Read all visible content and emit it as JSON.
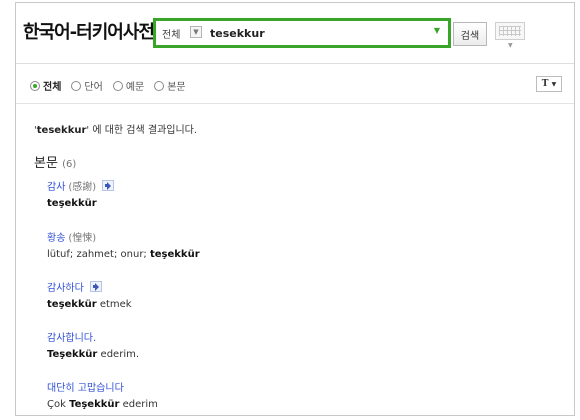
{
  "header": {
    "title": "한국어-터키어사전",
    "scope_label": "전체",
    "query_value": "tesekkur",
    "search_button": "검색"
  },
  "filters": [
    {
      "label": "전체",
      "selected": true
    },
    {
      "label": "단어",
      "selected": false
    },
    {
      "label": "예문",
      "selected": false
    },
    {
      "label": "본문",
      "selected": false
    }
  ],
  "font_button": "T",
  "summary": {
    "quote_open": "'",
    "term": "tesekkur",
    "quote_close": "'",
    "rest": " 에 대한 검색 결과입니다."
  },
  "section": {
    "title": "본문",
    "count": "(6)"
  },
  "entries": [
    {
      "word": "감사",
      "hanja": "(感謝)",
      "has_audio": true,
      "t_before": "",
      "t_bold": "teşekkür",
      "t_after": ""
    },
    {
      "word": "황송",
      "hanja": "(惶悚)",
      "has_audio": false,
      "t_before": "lütuf; zahmet; onur; ",
      "t_bold": "teşekkür",
      "t_after": ""
    },
    {
      "word": "감사하다",
      "hanja": "",
      "has_audio": true,
      "t_before": "",
      "t_bold": "teşekkür",
      "t_after": " etmek"
    },
    {
      "word": "감사합니다.",
      "hanja": "",
      "has_audio": false,
      "t_before": "",
      "t_bold": "Teşekkür",
      "t_after": " ederim."
    },
    {
      "word": "대단히 고맙습니다",
      "hanja": "",
      "has_audio": false,
      "t_before": "Çok ",
      "t_bold": "Teşekkür",
      "t_after": " ederim"
    }
  ],
  "colors": {
    "accent_green": "#3aa52a",
    "link_blue": "#2f4fd6"
  },
  "icons": [
    "chevron-down-icon",
    "keyboard-icon",
    "speaker-icon",
    "radio-icon"
  ]
}
